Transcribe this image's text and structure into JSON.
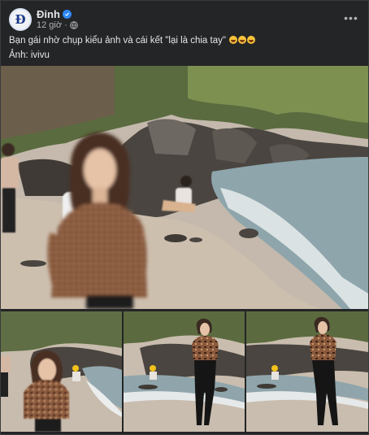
{
  "post": {
    "author": "Đỉnh",
    "time": "12 giờ",
    "caption_text": "Bạn gái nhờ chụp kiểu ảnh và cái kết \"lại là chia tay\"",
    "caption_emojis": [
      "rolling-on-floor-laughing",
      "rolling-on-floor-laughing",
      "rolling-on-floor-laughing"
    ],
    "credit": "Ảnh: ivivu"
  },
  "icons": {
    "verified": "verified-badge-icon",
    "privacy": "globe-icon",
    "more": "more-options-icon"
  },
  "colors": {
    "background": "#242526",
    "text": "#e4e6eb",
    "secondary_text": "#b0b3b8",
    "verified": "#2d88ff"
  }
}
